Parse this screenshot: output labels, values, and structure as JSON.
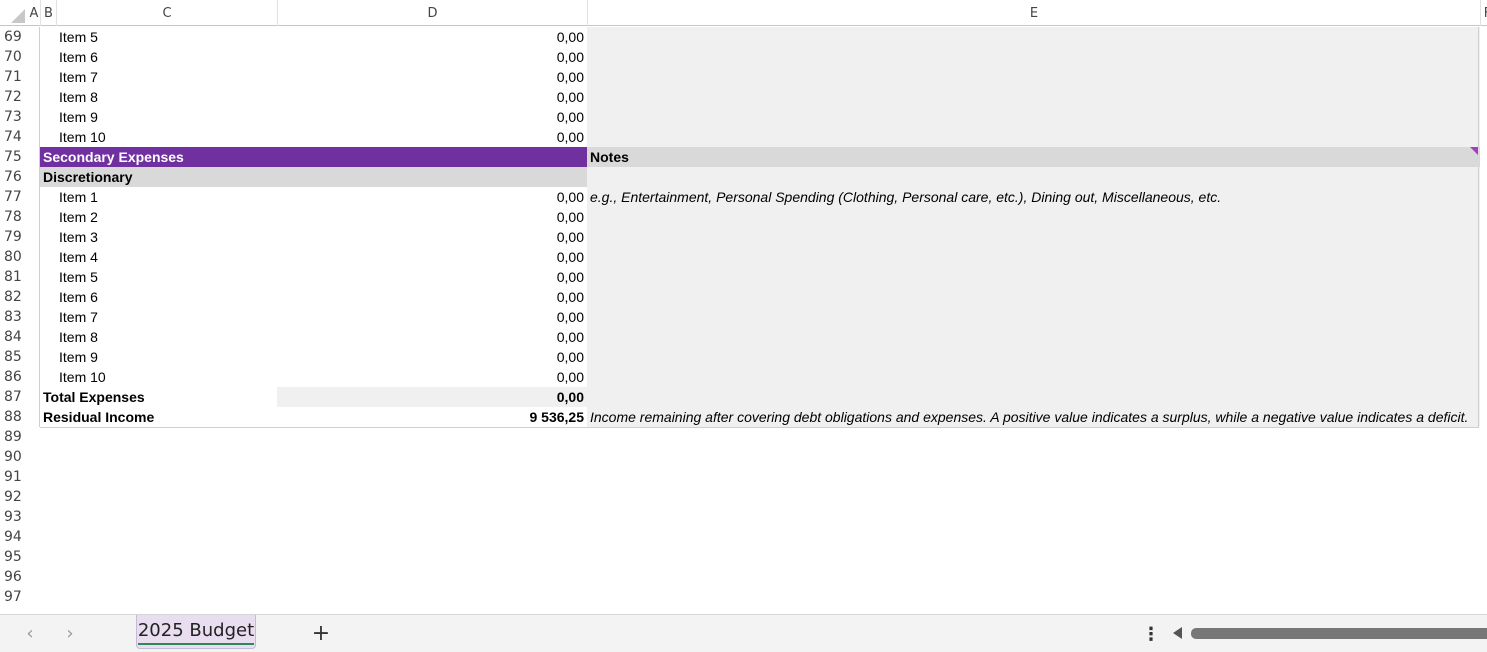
{
  "columns": {
    "a": "A",
    "b": "B",
    "c": "C",
    "d": "D",
    "e": "E",
    "f": "F"
  },
  "rows": [
    {
      "num": "69",
      "label": "Item 5",
      "value": "0,00",
      "note": ""
    },
    {
      "num": "70",
      "label": "Item 6",
      "value": "0,00",
      "note": ""
    },
    {
      "num": "71",
      "label": "Item 7",
      "value": "0,00",
      "note": ""
    },
    {
      "num": "72",
      "label": "Item 8",
      "value": "0,00",
      "note": ""
    },
    {
      "num": "73",
      "label": "Item 9",
      "value": "0,00",
      "note": ""
    },
    {
      "num": "74",
      "label": "Item 10",
      "value": "0,00",
      "note": ""
    },
    {
      "num": "75",
      "label": "Secondary Expenses",
      "value": "",
      "note": "Notes"
    },
    {
      "num": "76",
      "label": "Discretionary",
      "value": "",
      "note": ""
    },
    {
      "num": "77",
      "label": "Item 1",
      "value": "0,00",
      "note": "e.g., Entertainment, Personal Spending (Clothing, Personal care, etc.), Dining out, Miscellaneous, etc."
    },
    {
      "num": "78",
      "label": "Item 2",
      "value": "0,00",
      "note": ""
    },
    {
      "num": "79",
      "label": "Item 3",
      "value": "0,00",
      "note": ""
    },
    {
      "num": "80",
      "label": "Item 4",
      "value": "0,00",
      "note": ""
    },
    {
      "num": "81",
      "label": "Item 5",
      "value": "0,00",
      "note": ""
    },
    {
      "num": "82",
      "label": "Item 6",
      "value": "0,00",
      "note": ""
    },
    {
      "num": "83",
      "label": "Item 7",
      "value": "0,00",
      "note": ""
    },
    {
      "num": "84",
      "label": "Item 8",
      "value": "0,00",
      "note": ""
    },
    {
      "num": "85",
      "label": "Item 9",
      "value": "0,00",
      "note": ""
    },
    {
      "num": "86",
      "label": "Item 10",
      "value": "0,00",
      "note": ""
    },
    {
      "num": "87",
      "label": "Total Expenses",
      "value": "0,00",
      "note": ""
    },
    {
      "num": "88",
      "label": "Residual Income",
      "value": "9 536,25",
      "note": "Income remaining after covering debt obligations and expenses. A positive value indicates a surplus, while a negative value indicates a deficit."
    },
    {
      "num": "89",
      "label": "",
      "value": "",
      "note": ""
    },
    {
      "num": "90",
      "label": "",
      "value": "",
      "note": ""
    },
    {
      "num": "91",
      "label": "",
      "value": "",
      "note": ""
    },
    {
      "num": "92",
      "label": "",
      "value": "",
      "note": ""
    },
    {
      "num": "93",
      "label": "",
      "value": "",
      "note": ""
    },
    {
      "num": "94",
      "label": "",
      "value": "",
      "note": ""
    },
    {
      "num": "95",
      "label": "",
      "value": "",
      "note": ""
    },
    {
      "num": "96",
      "label": "",
      "value": "",
      "note": ""
    },
    {
      "num": "97",
      "label": "",
      "value": "",
      "note": ""
    }
  ],
  "colors": {
    "section_header": "#7030a0",
    "subheader": "#d9d9d9",
    "notes_bg": "#f0f0f0",
    "tab_active": "#e9ddf0"
  },
  "sheet_tabs": {
    "active": "2025 Budget"
  },
  "icons": {
    "prev": "chevron-left-icon",
    "next": "chevron-right-icon",
    "add": "plus-icon",
    "more": "more-vertical-icon"
  }
}
